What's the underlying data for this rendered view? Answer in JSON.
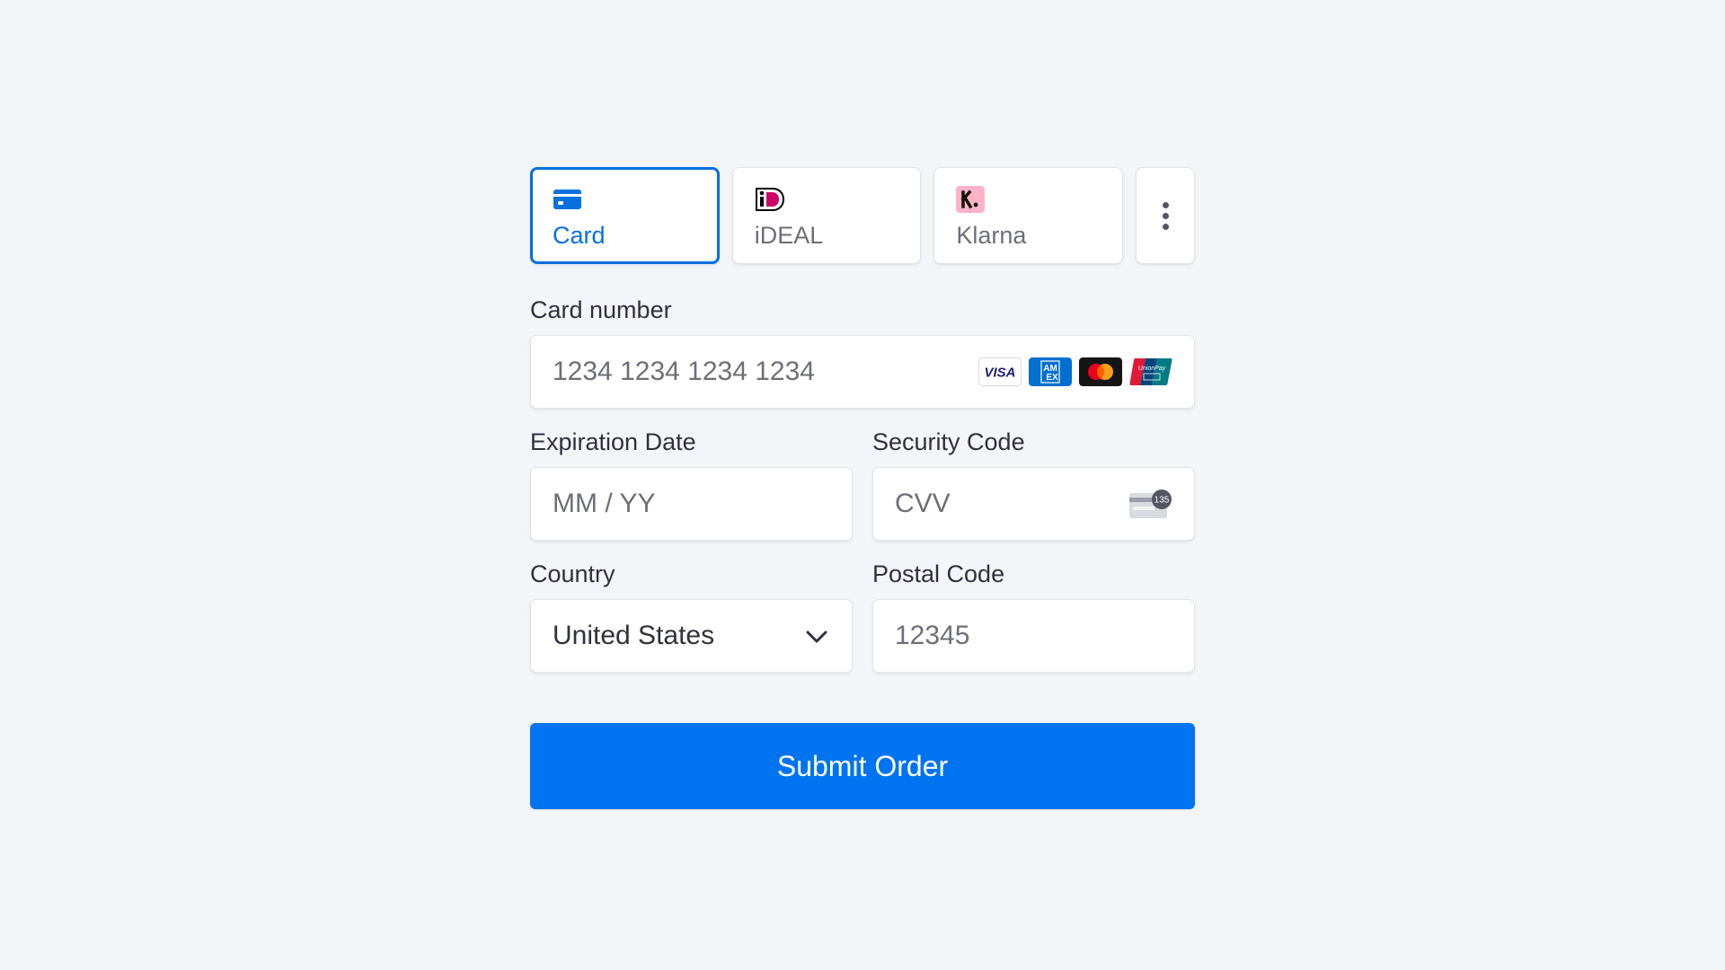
{
  "tabs": [
    {
      "label": "Card",
      "icon": "credit-card-icon",
      "active": true
    },
    {
      "label": "iDEAL",
      "icon": "ideal-logo-icon",
      "active": false
    },
    {
      "label": "Klarna",
      "icon": "klarna-logo-icon",
      "active": false
    },
    {
      "label": "",
      "icon": "more-vertical-icon",
      "active": false
    }
  ],
  "card_number": {
    "label": "Card number",
    "placeholder": "1234 1234 1234 1234",
    "brands": [
      "visa",
      "amex",
      "mastercard",
      "unionpay"
    ]
  },
  "expiration": {
    "label": "Expiration Date",
    "placeholder": "MM / YY"
  },
  "security_code": {
    "label": "Security Code",
    "placeholder": "CVV",
    "icon_text": "135"
  },
  "country": {
    "label": "Country",
    "selected": "United States"
  },
  "postal_code": {
    "label": "Postal Code",
    "placeholder": "12345"
  },
  "submit": {
    "label": "Submit Order"
  },
  "colors": {
    "background": "#f3f5f9",
    "accent": "#0570de",
    "button": "#0074f0",
    "text": "#30313d",
    "placeholder": "#6d6e78"
  }
}
